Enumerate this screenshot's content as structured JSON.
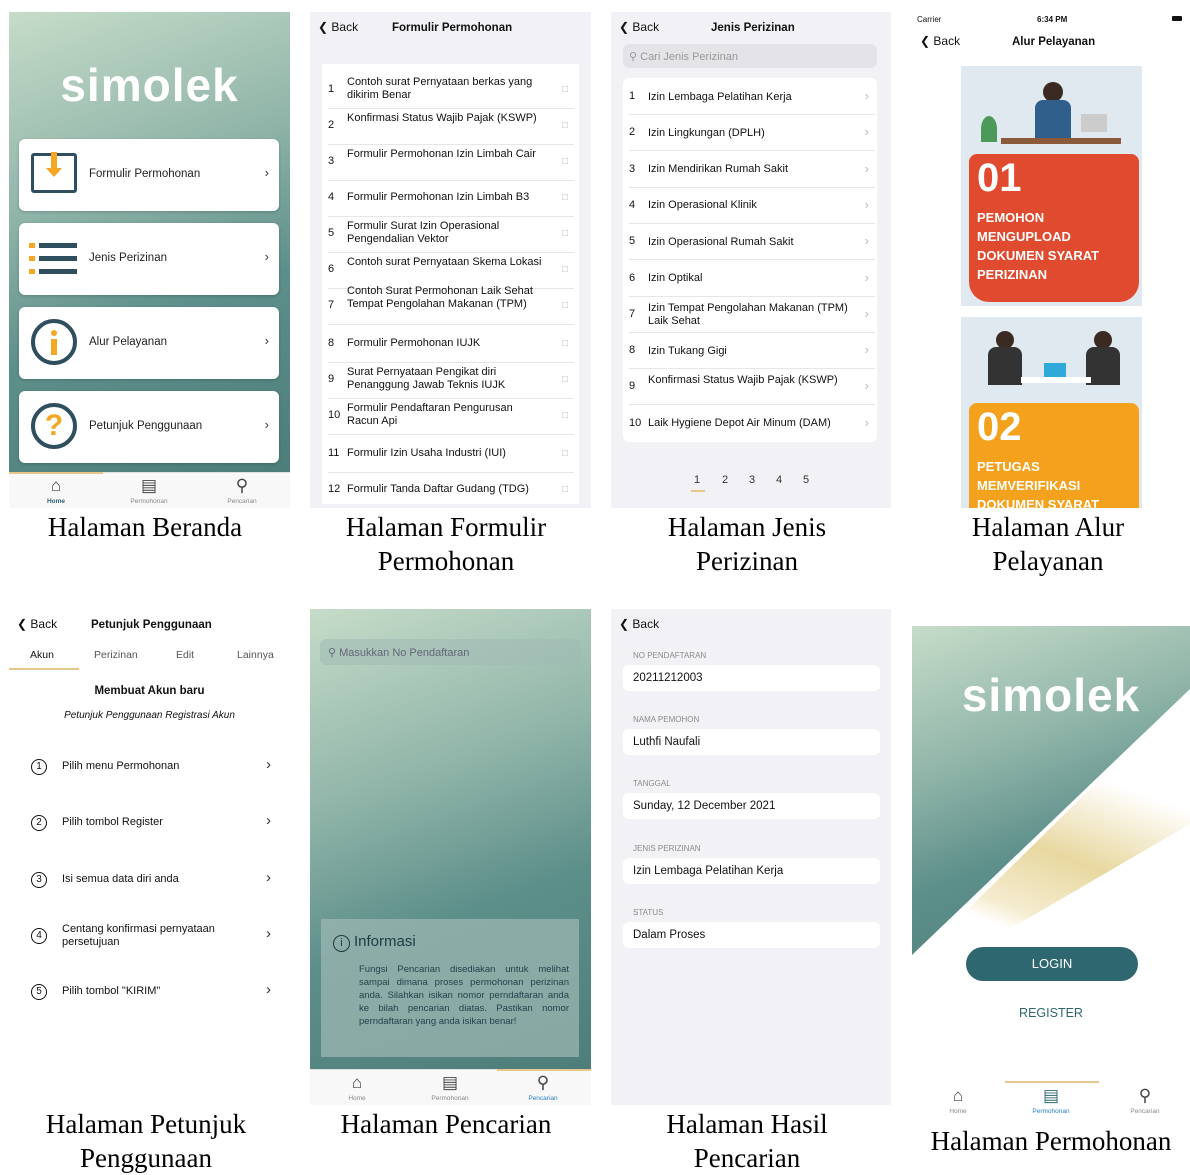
{
  "captions": {
    "home": "Halaman Beranda",
    "forms": "Halaman Formulir Permohonan",
    "permits": "Halaman Jenis Perizinan",
    "flow": "Halaman Alur Pelayanan",
    "guide": "Halaman Petunjuk Penggunaan",
    "search": "Halaman Pencarian",
    "result": "Halaman Hasil Pencarian",
    "application": "Halaman Permohonan"
  },
  "common": {
    "back": "Back",
    "brand": "simolek"
  },
  "tabs": {
    "home": "Home",
    "permohonan": "Permohonan",
    "pencarian": "Pencarian"
  },
  "home": {
    "menu": [
      {
        "label": "Formulir Permohonan",
        "icon": "download-box-icon"
      },
      {
        "label": "Jenis Perizinan",
        "icon": "list-icon"
      },
      {
        "label": "Alur Pelayanan",
        "icon": "info-circle-icon"
      },
      {
        "label": "Petunjuk Penggunaan",
        "icon": "question-circle-icon"
      }
    ]
  },
  "forms": {
    "title": "Formulir Permohonan",
    "items": [
      {
        "n": "1",
        "t": "Contoh surat Pernyataan berkas yang dikirim Benar"
      },
      {
        "n": "2",
        "t": "Konfirmasi Status Wajib Pajak (KSWP)"
      },
      {
        "n": "3",
        "t": "Formulir Permohonan Izin Limbah Cair"
      },
      {
        "n": "4",
        "t": "Formulir Permohonan Izin Limbah B3"
      },
      {
        "n": "5",
        "t": "Formulir Surat Izin Operasional Pengendalian Vektor"
      },
      {
        "n": "6",
        "t": "Contoh surat Pernyataan Skema Lokasi"
      },
      {
        "n": "7",
        "t": "Contoh Surat Permohonan Laik Sehat Tempat Pengolahan Makanan (TPM)"
      },
      {
        "n": "8",
        "t": "Formulir Permohonan IUJK"
      },
      {
        "n": "9",
        "t": "Surat Pernyataan Pengikat diri Penanggung Jawab Teknis IUJK"
      },
      {
        "n": "10",
        "t": "Formulir Pendaftaran Pengurusan Racun Api"
      },
      {
        "n": "11",
        "t": "Formulir Izin Usaha Industri (IUI)"
      },
      {
        "n": "12",
        "t": "Formulir Tanda Daftar Gudang (TDG)"
      }
    ]
  },
  "permits": {
    "title": "Jenis Perizinan",
    "search_placeholder": "Cari Jenis Perizinan",
    "items": [
      {
        "n": "1",
        "t": "Izin Lembaga Pelatihan Kerja"
      },
      {
        "n": "2",
        "t": "Izin Lingkungan (DPLH)"
      },
      {
        "n": "3",
        "t": "Izin Mendirikan Rumah Sakit"
      },
      {
        "n": "4",
        "t": "Izin Operasional Klinik"
      },
      {
        "n": "5",
        "t": "Izin Operasional Rumah Sakit"
      },
      {
        "n": "6",
        "t": "Izin Optikal"
      },
      {
        "n": "7",
        "t": "Izin Tempat Pengolahan Makanan (TPM) Laik Sehat"
      },
      {
        "n": "8",
        "t": "Izin Tukang Gigi"
      },
      {
        "n": "9",
        "t": "Konfirmasi Status Wajib Pajak (KSWP)"
      },
      {
        "n": "10",
        "t": "Laik Hygiene Depot Air Minum (DAM)"
      }
    ],
    "pages": [
      "1",
      "2",
      "3",
      "4",
      "5"
    ]
  },
  "flow": {
    "status_carrier": "Carrier",
    "status_time": "6:34 PM",
    "title": "Alur Pelayanan",
    "steps": [
      {
        "num": "01",
        "text": "PEMOHON MENGUPLOAD DOKUMEN SYARAT PERIZINAN"
      },
      {
        "num": "02",
        "text": "PETUGAS MEMVERIFIKASI DOKUMEN SYARAT"
      }
    ]
  },
  "guide": {
    "title": "Petunjuk Penggunaan",
    "tabs": [
      "Akun",
      "Perizinan",
      "Edit",
      "Lainnya"
    ],
    "heading": "Membuat Akun baru",
    "subheading": "Petunjuk Penggunaan Registrasi Akun",
    "steps": [
      {
        "n": "1",
        "t": "Pilih menu Permohonan"
      },
      {
        "n": "2",
        "t": "Pilih tombol Register"
      },
      {
        "n": "3",
        "t": "Isi semua data diri anda"
      },
      {
        "n": "4",
        "t": "Centang konfirmasi pernyataan persetujuan"
      },
      {
        "n": "5",
        "t": "Pilih tombol \"KIRIM\""
      }
    ]
  },
  "search": {
    "placeholder": "Masukkan No Pendaftaran",
    "info_title": "Informasi",
    "info_text": "Fungsi Pencarian disediakan untuk melihat sampai dimana proses permohonan perizinan anda. Silahkan isikan nomor perndaftaran anda ke bilah pencarian diatas. Pastikan nomor perndaftaran yang anda isikan benar!"
  },
  "result": {
    "fields": [
      {
        "label": "NO PENDAFTARAN",
        "value": "20211212003"
      },
      {
        "label": "NAMA PEMOHON",
        "value": "Luthfi Naufali"
      },
      {
        "label": "TANGGAL",
        "value": "Sunday, 12 December 2021"
      },
      {
        "label": "JENIS PERIZINAN",
        "value": "Izin Lembaga Pelatihan Kerja"
      },
      {
        "label": "STATUS",
        "value": "Dalam Proses"
      }
    ]
  },
  "application": {
    "login": "LOGIN",
    "register": "REGISTER"
  }
}
